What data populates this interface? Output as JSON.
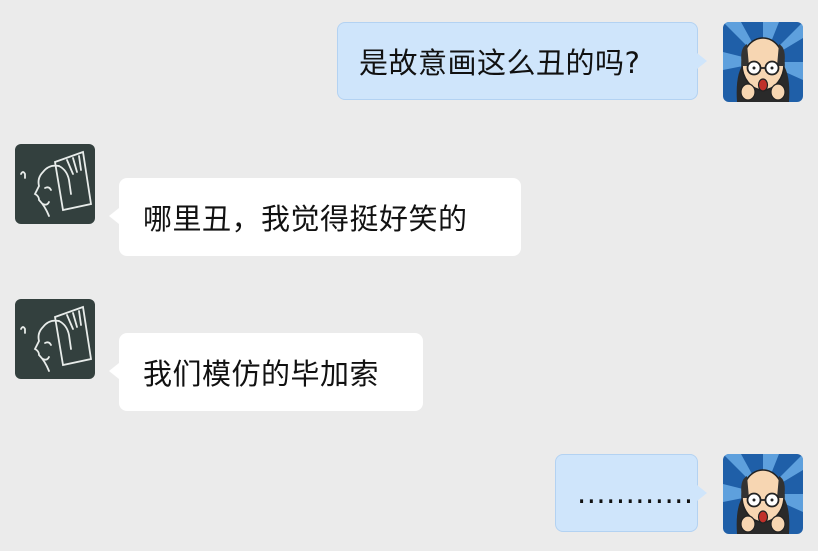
{
  "messages": [
    {
      "sender": "me",
      "text": "是故意画这么丑的吗?"
    },
    {
      "sender": "friend",
      "text": "哪里丑，我觉得挺好笑的"
    },
    {
      "sender": "friend",
      "text": "我们模仿的毕加索"
    },
    {
      "sender": "me",
      "text": "............"
    }
  ],
  "avatars": {
    "me": "cartoon-bald-man-avatar",
    "friend": "sketch-face-avatar"
  },
  "colors": {
    "background": "#ebebeb",
    "sent_bubble": "#cfe5fb",
    "received_bubble": "#ffffff"
  }
}
